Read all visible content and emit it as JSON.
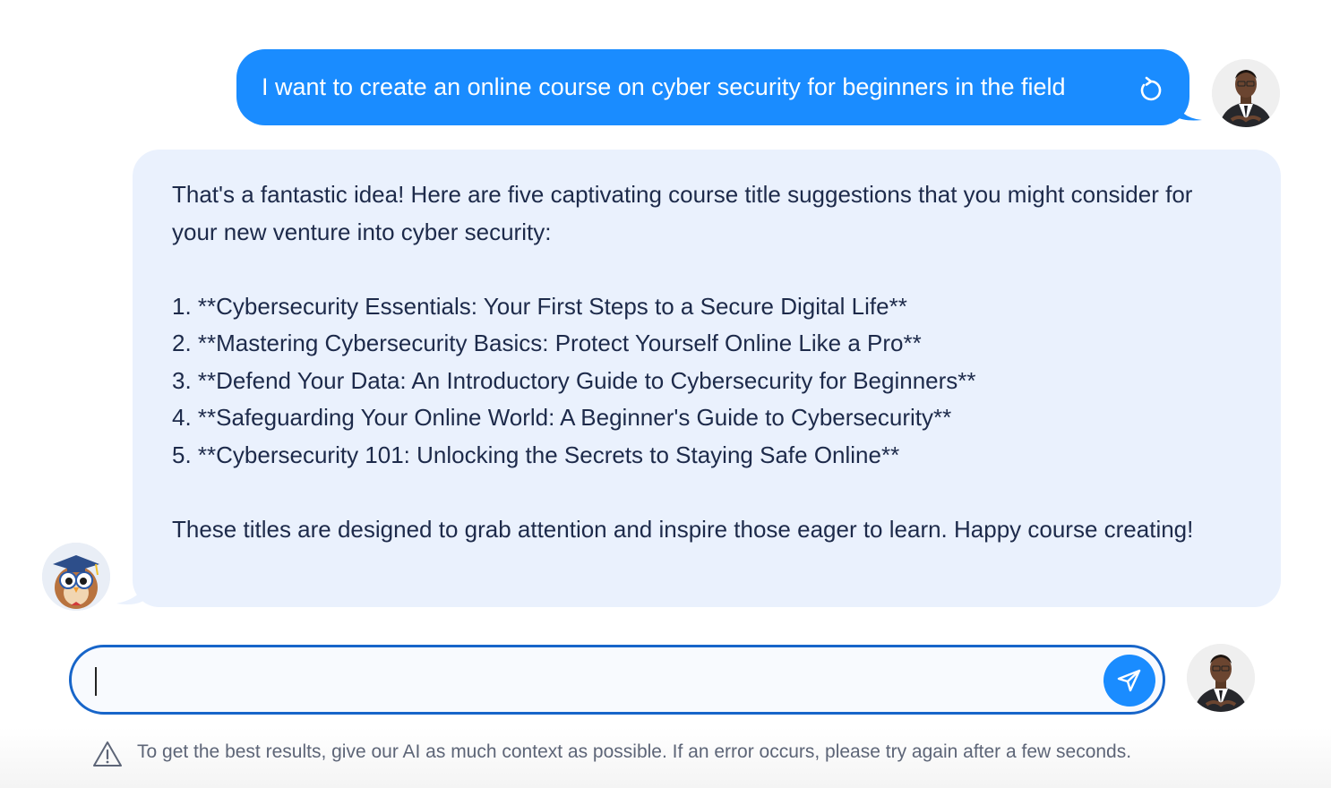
{
  "user_message": {
    "text": "I want to create an online course on cyber security for beginners in the field",
    "regenerate_icon": "refresh-icon"
  },
  "assistant_message": {
    "intro": "That's a fantastic idea! Here are five captivating course title suggestions that you might consider for your new venture into cyber security:",
    "items": [
      "1. **Cybersecurity Essentials: Your First Steps to a Secure Digital Life**",
      "2. **Mastering Cybersecurity Basics: Protect Yourself Online Like a Pro**",
      "3. **Defend Your Data: An Introductory Guide to Cybersecurity for Beginners**",
      "4. **Safeguarding Your Online World: A Beginner's Guide to Cybersecurity**",
      "5. **Cybersecurity 101: Unlocking the Secrets to Staying Safe Online**"
    ],
    "outro": "These titles are designed to grab attention and inspire those eager to learn. Happy course creating!"
  },
  "composer": {
    "value": "",
    "placeholder": "",
    "send_icon": "send-icon"
  },
  "footer": {
    "notice": "To get the best results, give our AI as much context as possible. If an error occurs, please try again after a few seconds.",
    "icon": "warning-icon"
  },
  "colors": {
    "user_bubble": "#1a8cff",
    "assistant_bubble": "#eaf1fd",
    "input_border": "#1765c9",
    "send_button": "#1a8cff"
  }
}
